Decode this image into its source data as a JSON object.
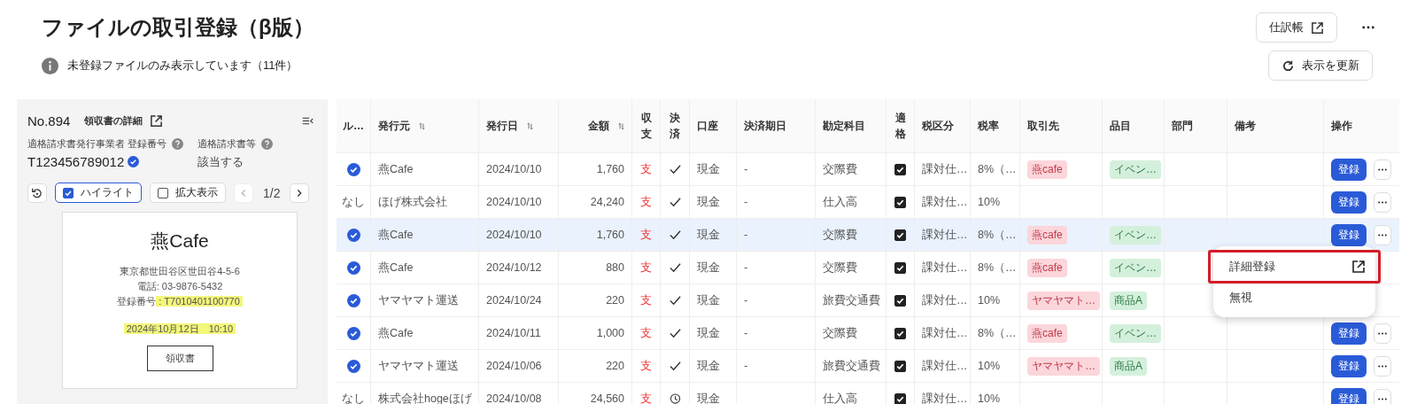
{
  "title": "ファイルの取引登録（β版）",
  "info": "未登録ファイルのみ表示しています（11件）",
  "journal_button": "仕訳帳",
  "refresh_button": "表示を更新",
  "panel": {
    "number": "No.894",
    "detail_link": "領収書の詳細",
    "fields": [
      {
        "label": "適格請求書発行事業者 登録番号",
        "value": "T123456789012",
        "verified": true
      },
      {
        "label": "適格請求書等",
        "value": "該当する",
        "verified": false
      }
    ],
    "toggles": [
      {
        "label": "ハイライト",
        "checked": true
      },
      {
        "label": "拡大表示",
        "checked": false
      }
    ],
    "page": "1/2",
    "receipt": {
      "shop": "燕Cafe",
      "lines": [
        [
          {
            "text": "東京都世田谷区世田谷4-5-6",
            "highlight": false
          }
        ],
        [
          {
            "text": "電話: 03-9876-5432",
            "highlight": false
          }
        ],
        [
          {
            "text": "登録番号",
            "highlight": false
          },
          {
            "text": ": T7010401100770",
            "highlight": true
          }
        ],
        [
          {
            "text": "2024年10月12日　10:10",
            "highlight": true
          }
        ]
      ],
      "stamp": "領収書"
    }
  },
  "table": {
    "columns": [
      {
        "label": "ル…",
        "sortable": false
      },
      {
        "label": "発行元",
        "sortable": true
      },
      {
        "label": "発行日",
        "sortable": true
      },
      {
        "label": "金額",
        "sortable": true
      },
      {
        "label": "収支",
        "sortable": false
      },
      {
        "label": "決済",
        "sortable": false
      },
      {
        "label": "口座",
        "sortable": false
      },
      {
        "label": "決済期日",
        "sortable": false
      },
      {
        "label": "勘定科目",
        "sortable": false
      },
      {
        "label": "適格",
        "sortable": false
      },
      {
        "label": "税区分",
        "sortable": false
      },
      {
        "label": "税率",
        "sortable": false
      },
      {
        "label": "取引先",
        "sortable": false
      },
      {
        "label": "品目",
        "sortable": false
      },
      {
        "label": "部門",
        "sortable": false
      },
      {
        "label": "備考",
        "sortable": false
      },
      {
        "label": "操作",
        "sortable": false
      }
    ],
    "rows": [
      {
        "selected": false,
        "rule": {
          "kind": "check"
        },
        "issuer": "燕Cafe",
        "date": "2024/10/10",
        "amount": "1,760",
        "flow": "支",
        "settle": {
          "kind": "check"
        },
        "account": "現金",
        "due": "-",
        "category": "交際費",
        "qualified": true,
        "tax": "課対仕…",
        "rate": "8%（…",
        "partner": "燕cafe",
        "item": "イベン…",
        "register": "登録"
      },
      {
        "selected": false,
        "rule": {
          "kind": "text",
          "text": "なし"
        },
        "issuer": "ほげ株式会社",
        "date": "2024/10/10",
        "amount": "24,240",
        "flow": "支",
        "settle": {
          "kind": "check"
        },
        "account": "現金",
        "due": "-",
        "category": "仕入高",
        "qualified": true,
        "tax": "課対仕…",
        "rate": "10%",
        "register": "登録"
      },
      {
        "selected": true,
        "rule": {
          "kind": "check"
        },
        "issuer": "燕Cafe",
        "date": "2024/10/10",
        "amount": "1,760",
        "flow": "支",
        "settle": {
          "kind": "check"
        },
        "account": "現金",
        "due": "-",
        "category": "交際費",
        "qualified": true,
        "tax": "課対仕…",
        "rate": "8%（…",
        "partner": "燕cafe",
        "item": "イベン…",
        "register": "登録"
      },
      {
        "selected": false,
        "rule": {
          "kind": "check"
        },
        "issuer": "燕Cafe",
        "date": "2024/10/12",
        "amount": "880",
        "flow": "支",
        "settle": {
          "kind": "check"
        },
        "account": "現金",
        "due": "-",
        "category": "交際費",
        "qualified": true,
        "tax": "課対仕…",
        "rate": "8%（…",
        "partner": "燕cafe",
        "item": "イベン…"
      },
      {
        "selected": false,
        "rule": {
          "kind": "check"
        },
        "issuer": "ヤマヤマト運送",
        "date": "2024/10/24",
        "amount": "220",
        "flow": "支",
        "settle": {
          "kind": "check"
        },
        "account": "現金",
        "due": "-",
        "category": "旅費交通費",
        "qualified": true,
        "tax": "課対仕…",
        "rate": "10%",
        "partner": "ヤマヤマト…",
        "item": "商品A"
      },
      {
        "selected": false,
        "rule": {
          "kind": "check"
        },
        "issuer": "燕Cafe",
        "date": "2024/10/11",
        "amount": "1,000",
        "flow": "支",
        "settle": {
          "kind": "check"
        },
        "account": "現金",
        "due": "-",
        "category": "交際費",
        "qualified": true,
        "tax": "課対仕…",
        "rate": "8%（…",
        "partner": "燕cafe",
        "item": "イベン…",
        "register": "登録"
      },
      {
        "selected": false,
        "rule": {
          "kind": "check"
        },
        "issuer": "ヤマヤマト運送",
        "date": "2024/10/06",
        "amount": "220",
        "flow": "支",
        "settle": {
          "kind": "check"
        },
        "account": "現金",
        "due": "-",
        "category": "旅費交通費",
        "qualified": true,
        "tax": "課対仕…",
        "rate": "10%",
        "partner": "ヤマヤマト…",
        "item": "商品A",
        "register": "登録"
      },
      {
        "selected": false,
        "rule": {
          "kind": "text",
          "text": "なし"
        },
        "issuer": "株式会社hogeほげ",
        "date": "2024/10/08",
        "amount": "24,560",
        "flow": "支",
        "settle": {
          "kind": "clock"
        },
        "account": "現金",
        "category": "仕入高",
        "qualified": true,
        "tax": "課対仕…",
        "rate": "10%",
        "register": "登録"
      }
    ]
  },
  "menu": {
    "items": [
      {
        "label": "詳細登録",
        "external": true,
        "highlighted": true
      },
      {
        "label": "無視",
        "external": false,
        "highlighted": false
      }
    ]
  }
}
